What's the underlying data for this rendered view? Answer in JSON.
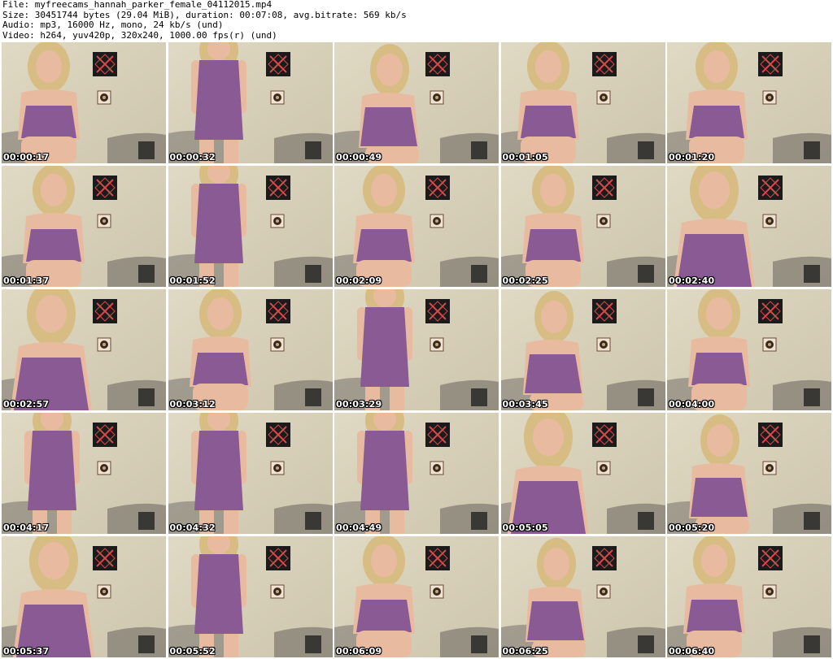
{
  "header": {
    "file": "File: myfreecams_hannah_parker_female_04112015.mp4",
    "size": "Size: 30451744 bytes (29.04 MiB), duration: 00:07:08, avg.bitrate: 569 kb/s",
    "audio": "Audio: mp3, 16000 Hz, mono, 24 kb/s (und)",
    "video": "Video: h264, yuv420p, 320x240, 1000.00 fps(r) (und)"
  },
  "thumbnails": [
    {
      "time": "00:00:17",
      "pose": "seated"
    },
    {
      "time": "00:00:32",
      "pose": "standing"
    },
    {
      "time": "00:00:49",
      "pose": "leaning"
    },
    {
      "time": "00:01:05",
      "pose": "seated"
    },
    {
      "time": "00:01:20",
      "pose": "seated"
    },
    {
      "time": "00:01:37",
      "pose": "seated"
    },
    {
      "time": "00:01:52",
      "pose": "standing"
    },
    {
      "time": "00:02:09",
      "pose": "seated"
    },
    {
      "time": "00:02:25",
      "pose": "seated"
    },
    {
      "time": "00:02:40",
      "pose": "close"
    },
    {
      "time": "00:02:57",
      "pose": "close"
    },
    {
      "time": "00:03:12",
      "pose": "seated"
    },
    {
      "time": "00:03:29",
      "pose": "standing"
    },
    {
      "time": "00:03:45",
      "pose": "leaning"
    },
    {
      "time": "00:04:00",
      "pose": "seated"
    },
    {
      "time": "00:04:17",
      "pose": "standing"
    },
    {
      "time": "00:04:32",
      "pose": "standing"
    },
    {
      "time": "00:04:49",
      "pose": "standing"
    },
    {
      "time": "00:05:05",
      "pose": "close"
    },
    {
      "time": "00:05:20",
      "pose": "leaning"
    },
    {
      "time": "00:05:37",
      "pose": "close"
    },
    {
      "time": "00:05:52",
      "pose": "standing"
    },
    {
      "time": "00:06:09",
      "pose": "seated"
    },
    {
      "time": "00:06:25",
      "pose": "leaning"
    },
    {
      "time": "00:06:40",
      "pose": "seated"
    }
  ],
  "colors": {
    "wall": "#cdc5ad",
    "dress": "#8a5a95",
    "skin": "#e8bba0",
    "hair": "#d7bd84",
    "frame": "#1b1b1b",
    "frame_x": "#d44a4a",
    "bedding": "#8f8a80"
  }
}
